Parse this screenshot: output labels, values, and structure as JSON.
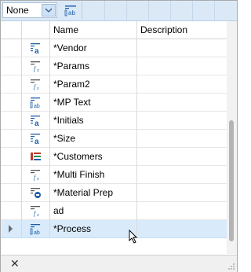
{
  "toolbar": {
    "combo_value": "None",
    "combo_button_icon": "chevron-down-icon",
    "field_icon": "text-field-ab-icon"
  },
  "grid": {
    "columns": [
      "Name",
      "Description"
    ],
    "rows": [
      {
        "name": "*Vendor",
        "description": "",
        "icon": "text-a-icon",
        "selected": false
      },
      {
        "name": "*Params",
        "description": "",
        "icon": "formula-fx-icon",
        "selected": false
      },
      {
        "name": "*Param2",
        "description": "",
        "icon": "formula-fx-icon",
        "selected": false
      },
      {
        "name": "*MP Text",
        "description": "",
        "icon": "text-field-ab-icon",
        "selected": false
      },
      {
        "name": "*Initials",
        "description": "",
        "icon": "text-a-icon",
        "selected": false
      },
      {
        "name": "*Size",
        "description": "",
        "icon": "text-a-icon",
        "selected": false
      },
      {
        "name": "*Customers",
        "description": "",
        "icon": "list-colored-icon",
        "selected": false
      },
      {
        "name": "*Multi Finish",
        "description": "",
        "icon": "formula-fx-icon",
        "selected": false
      },
      {
        "name": "*Material Prep",
        "description": "",
        "icon": "list-circle-icon",
        "selected": false
      },
      {
        "name": "ad",
        "description": "",
        "icon": "formula-fx-icon",
        "selected": false
      },
      {
        "name": "*Process",
        "description": "",
        "icon": "text-field-ab-icon",
        "selected": true
      }
    ]
  },
  "bottombar": {
    "close_icon": "close-icon",
    "close_glyph": "✕"
  },
  "colors": {
    "toolbar_bg": "#dbe9f7",
    "selected_row": "#d9ebfb",
    "icon_blue": "#1f5fa8"
  }
}
